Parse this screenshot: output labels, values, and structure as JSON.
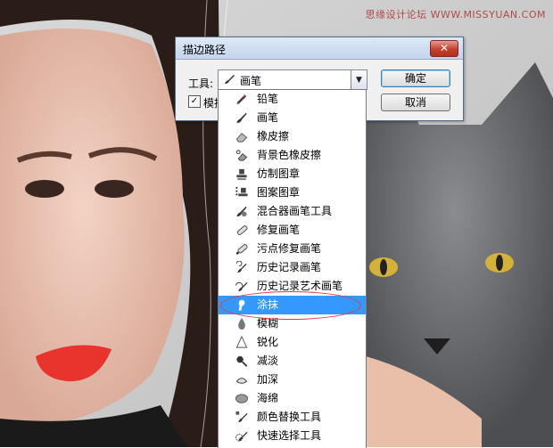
{
  "watermark": "思缘设计论坛 WWW.MISSYUAN.COM",
  "dialog": {
    "title": "描边路径",
    "close_glyph": "✕",
    "tool_label": "工具:",
    "selected_tool": "画笔",
    "checkbox_label": "模拟压力",
    "checkbox_checked": true,
    "ok_label": "确定",
    "cancel_label": "取消"
  },
  "dropdown": {
    "selected_index": 11,
    "items": [
      {
        "label": "铅笔",
        "icon": "pencil-icon"
      },
      {
        "label": "画笔",
        "icon": "brush-icon"
      },
      {
        "label": "橡皮擦",
        "icon": "eraser-icon"
      },
      {
        "label": "背景色橡皮擦",
        "icon": "background-eraser-icon"
      },
      {
        "label": "仿制图章",
        "icon": "clone-stamp-icon"
      },
      {
        "label": "图案图章",
        "icon": "pattern-stamp-icon"
      },
      {
        "label": "混合器画笔工具",
        "icon": "mixer-brush-icon"
      },
      {
        "label": "修复画笔",
        "icon": "healing-brush-icon"
      },
      {
        "label": "污点修复画笔",
        "icon": "spot-healing-brush-icon"
      },
      {
        "label": "历史记录画笔",
        "icon": "history-brush-icon"
      },
      {
        "label": "历史记录艺术画笔",
        "icon": "art-history-brush-icon"
      },
      {
        "label": "涂抹",
        "icon": "smudge-icon"
      },
      {
        "label": "模糊",
        "icon": "blur-icon"
      },
      {
        "label": "锐化",
        "icon": "sharpen-icon"
      },
      {
        "label": "减淡",
        "icon": "dodge-icon"
      },
      {
        "label": "加深",
        "icon": "burn-icon"
      },
      {
        "label": "海绵",
        "icon": "sponge-icon"
      },
      {
        "label": "颜色替换工具",
        "icon": "color-replacement-icon"
      },
      {
        "label": "快速选择工具",
        "icon": "quick-selection-icon"
      }
    ]
  },
  "colors": {
    "selection": "#3399ff",
    "annotation": "#e23a3a"
  }
}
